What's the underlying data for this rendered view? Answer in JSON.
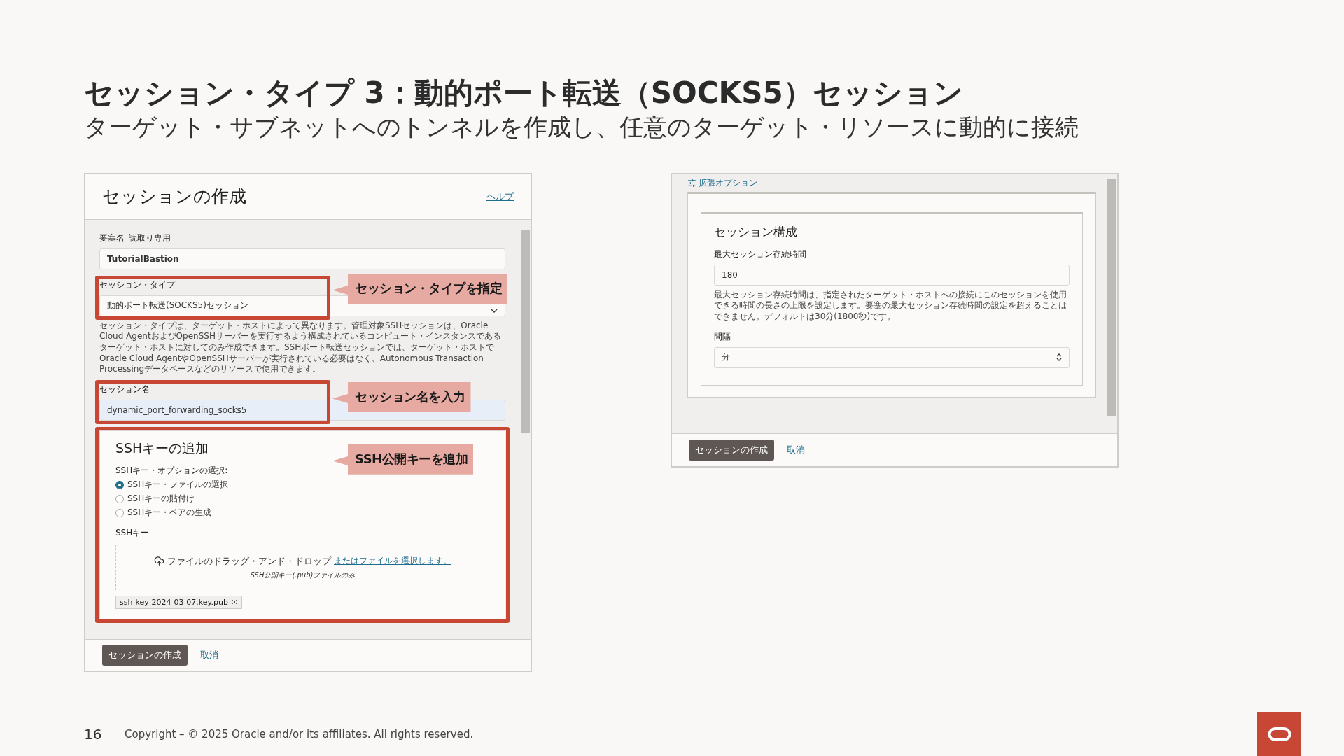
{
  "slide": {
    "title": "セッション・タイプ 3：動的ポート転送（SOCKS5）セッション",
    "subtitle": "ターゲット・サブネットへのトンネルを作成し、任意のターゲット・リソースに動的に接続"
  },
  "left_dialog": {
    "title": "セッションの作成",
    "help_link": "ヘルプ",
    "bastion_label": "要塞名",
    "bastion_note": "読取り専用",
    "bastion_value": "TutorialBastion",
    "type_label": "セッション・タイプ",
    "type_value": "動的ポート転送(SOCKS5)セッション",
    "type_help": "セッション・タイプは、ターゲット・ホストによって異なります。管理対象SSHセッションは、Oracle Cloud AgentおよびOpenSSHサーバーを実行するよう構成されているコンピュート・インスタンスであるターゲット・ホストに対してのみ作成できます。SSHポート転送セッションでは、ターゲット・ホストでOracle Cloud AgentやOpenSSHサーバーが実行されている必要はなく、Autonomous Transaction Processingデータベースなどのリソースで使用できます。",
    "name_label": "セッション名",
    "name_value": "dynamic_port_forwarding_socks5",
    "ssh_card": {
      "title": "SSHキーの追加",
      "options_label": "SSHキー・オプションの選択:",
      "options": [
        {
          "label": "SSHキー・ファイルの選択",
          "selected": true
        },
        {
          "label": "SSHキーの貼付け",
          "selected": false
        },
        {
          "label": "SSHキー・ペアの生成",
          "selected": false
        }
      ],
      "key_label": "SSHキー",
      "drop_text": "ファイルのドラッグ・アンド・ドロップ",
      "drop_link": "またはファイルを選択します。",
      "drop_hint": "SSH公開キー(.pub)ファイルのみ",
      "file_chip": "ssh-key-2024-03-07.key.pub"
    },
    "create_button": "セッションの作成",
    "cancel_link": "取消"
  },
  "callouts": [
    {
      "text": "セッション・タイプを指定"
    },
    {
      "text": "セッション名を入力"
    },
    {
      "text": "SSH公開キーを追加"
    }
  ],
  "right_dialog": {
    "advanced_link": "拡張オプション",
    "card_title": "セッション構成",
    "ttl_label": "最大セッション存続時間",
    "ttl_value": "180",
    "ttl_help": "最大セッション存続時間は、指定されたターゲット・ホストへの接続にこのセッションを使用できる時間の長さの上限を設定します。要塞の最大セッション存続時間の設定を超えることはできません。デフォルトは30分(1800秒)です。",
    "interval_label": "間隔",
    "interval_value": "分",
    "create_button": "セッションの作成",
    "cancel_link": "取消"
  },
  "footer": {
    "page_number": "16",
    "copyright": "Copyright – © 2025 Oracle and/or its affiliates. All rights reserved."
  }
}
